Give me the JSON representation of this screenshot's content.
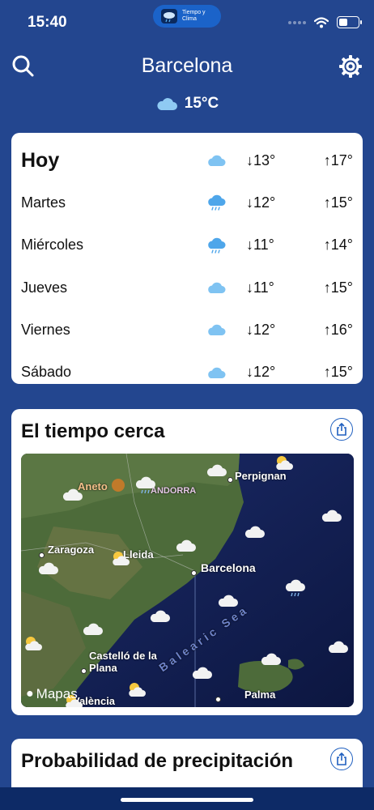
{
  "status_bar": {
    "time": "15:40",
    "app_pill_label": "Tiempo y Clima",
    "battery_level_pct": 45
  },
  "header": {
    "city": "Barcelona",
    "current_temp": "15°C",
    "current_icon": "cloud-icon"
  },
  "forecast": [
    {
      "day": "Hoy",
      "icon": "cloud-icon",
      "min": "↓13°",
      "max": "↑17°"
    },
    {
      "day": "Martes",
      "icon": "rain-cloud-icon",
      "min": "↓12°",
      "max": "↑15°"
    },
    {
      "day": "Miércoles",
      "icon": "rain-cloud-icon",
      "min": "↓11°",
      "max": "↑14°"
    },
    {
      "day": "Jueves",
      "icon": "cloud-icon",
      "min": "↓11°",
      "max": "↑15°"
    },
    {
      "day": "Viernes",
      "icon": "cloud-icon",
      "min": "↓12°",
      "max": "↑16°"
    },
    {
      "day": "Sábado",
      "icon": "cloud-icon",
      "min": "↓12°",
      "max": "↑15°"
    }
  ],
  "map_section": {
    "title": "El tiempo cerca",
    "labels": {
      "perpignan": "Perpignan",
      "aneto": "Aneto",
      "andorra": "ANDORRA",
      "zaragoza": "Zaragoza",
      "lleida": "Lleida",
      "barcelona": "Barcelona",
      "balearic_sea": "Balearic Sea",
      "castello": "Castelló de la Plana",
      "palma": "Palma",
      "valencia": "València",
      "maps_brand": "Mapas"
    }
  },
  "precip_section": {
    "title": "Probabilidad de precipitación"
  },
  "colors": {
    "background": "#23468f",
    "accent": "#1f5fbf",
    "cloud": "#7fc3f2"
  }
}
